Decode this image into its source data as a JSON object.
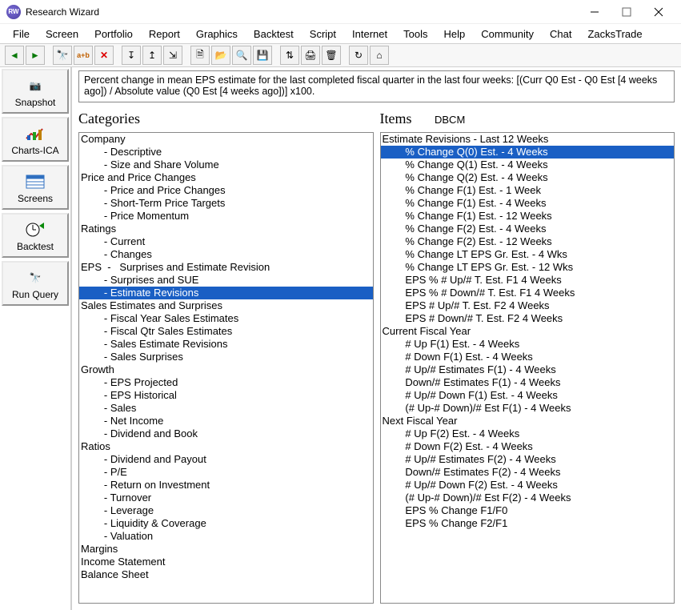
{
  "window": {
    "title": "Research Wizard"
  },
  "menu": [
    "File",
    "Screen",
    "Portfolio",
    "Report",
    "Graphics",
    "Backtest",
    "Script",
    "Internet",
    "Tools",
    "Help",
    "Community",
    "Chat",
    "ZacksTrade"
  ],
  "toolbar": [
    "arrow-left",
    "arrow-right",
    "|",
    "binoculars",
    "a-plus-b",
    "x-red",
    "|",
    "stick-down",
    "stick-up",
    "stick-right",
    "|",
    "doc-new",
    "folder-open",
    "doc-mag",
    "floppy",
    "|",
    "sort",
    "printer",
    "trash",
    "|",
    "refresh",
    "home"
  ],
  "sidebar": [
    {
      "label": "Snapshot",
      "icon": "camera"
    },
    {
      "label": "Charts-ICA",
      "icon": "chart"
    },
    {
      "label": "Screens",
      "icon": "grid"
    },
    {
      "label": "Backtest",
      "icon": "backtest"
    },
    {
      "label": "Run Query",
      "icon": "binoc"
    }
  ],
  "description": "Percent change in mean EPS estimate for the last completed fiscal quarter in the last four weeks:   [(Curr Q0 Est - Q0 Est [4 weeks ago]) / Absolute value (Q0 Est [4 weeks ago])] x100.",
  "categories_label": "Categories",
  "items_label": "Items",
  "items_extra": "DBCM",
  "categories": [
    {
      "t": "Company",
      "i": 0
    },
    {
      "t": "- Descriptive",
      "i": 1
    },
    {
      "t": "- Size and Share Volume",
      "i": 1
    },
    {
      "t": "Price and Price Changes",
      "i": 0
    },
    {
      "t": "- Price and Price Changes",
      "i": 1
    },
    {
      "t": "- Short-Term Price Targets",
      "i": 1
    },
    {
      "t": "- Price Momentum",
      "i": 1
    },
    {
      "t": "Ratings",
      "i": 0
    },
    {
      "t": "- Current",
      "i": 1
    },
    {
      "t": "- Changes",
      "i": 1
    },
    {
      "t": "EPS  -   Surprises and Estimate Revision",
      "i": 0
    },
    {
      "t": "- Surprises and SUE",
      "i": 1
    },
    {
      "t": "- Estimate Revisions",
      "i": 1,
      "sel": true
    },
    {
      "t": "Sales Estimates and Surprises",
      "i": 0
    },
    {
      "t": "- Fiscal Year Sales Estimates",
      "i": 1
    },
    {
      "t": "- Fiscal Qtr Sales Estimates",
      "i": 1
    },
    {
      "t": "- Sales Estimate Revisions",
      "i": 1
    },
    {
      "t": "- Sales Surprises",
      "i": 1
    },
    {
      "t": "Growth",
      "i": 0
    },
    {
      "t": "- EPS Projected",
      "i": 1
    },
    {
      "t": "- EPS Historical",
      "i": 1
    },
    {
      "t": "- Sales",
      "i": 1
    },
    {
      "t": "- Net Income",
      "i": 1
    },
    {
      "t": "- Dividend and Book",
      "i": 1
    },
    {
      "t": "Ratios",
      "i": 0
    },
    {
      "t": "- Dividend and Payout",
      "i": 1
    },
    {
      "t": "- P/E",
      "i": 1
    },
    {
      "t": "- Return on Investment",
      "i": 1
    },
    {
      "t": "- Turnover",
      "i": 1
    },
    {
      "t": "- Leverage",
      "i": 1
    },
    {
      "t": "- Liquidity & Coverage",
      "i": 1
    },
    {
      "t": "- Valuation",
      "i": 1
    },
    {
      "t": "Margins",
      "i": 0
    },
    {
      "t": "Income Statement",
      "i": 0
    },
    {
      "t": "Balance Sheet",
      "i": 0
    }
  ],
  "items": [
    {
      "t": "Estimate Revisions - Last 12 Weeks",
      "i": 0
    },
    {
      "t": "% Change Q(0) Est. - 4 Weeks",
      "i": 1,
      "sel": true
    },
    {
      "t": "% Change Q(1) Est. - 4 Weeks",
      "i": 1
    },
    {
      "t": "% Change Q(2) Est. - 4 Weeks",
      "i": 1
    },
    {
      "t": "% Change F(1) Est. - 1 Week",
      "i": 1
    },
    {
      "t": "% Change F(1) Est. - 4 Weeks",
      "i": 1
    },
    {
      "t": "% Change F(1) Est. - 12 Weeks",
      "i": 1
    },
    {
      "t": "% Change F(2) Est. - 4 Weeks",
      "i": 1
    },
    {
      "t": "% Change F(2) Est. - 12 Weeks",
      "i": 1
    },
    {
      "t": "% Change LT EPS Gr. Est. - 4 Wks",
      "i": 1
    },
    {
      "t": "% Change LT EPS Gr. Est. - 12 Wks",
      "i": 1
    },
    {
      "t": "EPS % # Up/# T. Est. F1 4 Weeks",
      "i": 1
    },
    {
      "t": "EPS % # Down/# T. Est. F1 4 Weeks",
      "i": 1
    },
    {
      "t": "EPS # Up/# T. Est. F2 4 Weeks",
      "i": 1
    },
    {
      "t": "EPS # Down/# T. Est. F2 4 Weeks",
      "i": 1
    },
    {
      "t": "Current Fiscal Year",
      "i": 0
    },
    {
      "t": "# Up F(1) Est. - 4 Weeks",
      "i": 1
    },
    {
      "t": "# Down F(1) Est. - 4 Weeks",
      "i": 1
    },
    {
      "t": "# Up/# Estimates F(1) - 4 Weeks",
      "i": 1
    },
    {
      "t": "Down/# Estimates F(1) - 4 Weeks",
      "i": 1
    },
    {
      "t": "# Up/# Down F(1) Est. - 4 Weeks",
      "i": 1
    },
    {
      "t": "(# Up-# Down)/# Est F(1) - 4 Weeks",
      "i": 1
    },
    {
      "t": "Next Fiscal Year",
      "i": 0
    },
    {
      "t": "# Up F(2) Est. - 4 Weeks",
      "i": 1
    },
    {
      "t": "# Down F(2) Est. - 4 Weeks",
      "i": 1
    },
    {
      "t": "# Up/# Estimates F(2) - 4 Weeks",
      "i": 1
    },
    {
      "t": "Down/# Estimates F(2) - 4 Weeks",
      "i": 1
    },
    {
      "t": "# Up/# Down F(2) Est. - 4 Weeks",
      "i": 1
    },
    {
      "t": "(# Up-# Down)/# Est F(2) - 4 Weeks",
      "i": 1
    },
    {
      "t": "EPS % Change F1/F0",
      "i": 1
    },
    {
      "t": "EPS % Change F2/F1",
      "i": 1
    }
  ]
}
